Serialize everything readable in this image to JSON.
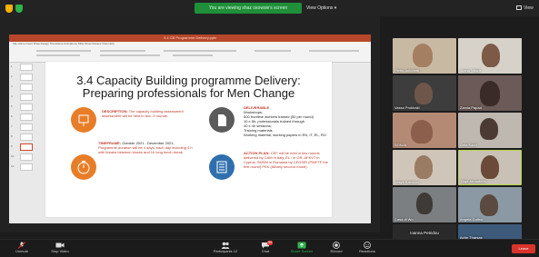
{
  "topbar": {
    "banner": "You are viewing shaz osowsie's screen",
    "view_options": "View Options",
    "view": "View"
  },
  "ppt": {
    "title_bar": "3.4 CB Programme Delivery.pptx",
    "ribbon_tabs": "File   Home   Insert   Draw   Design   Transitions   Animations   Slide Show   Review   View   Help"
  },
  "slide": {
    "title_line1": "3.4 Capacity Building programme Delivery:",
    "title_line2": "Preparing professionals for Men Change",
    "description_label": "DESCRIPTION:",
    "description_text": "The capacity building assessment assessment will be held in two -3 rounds.",
    "timeframe_label": "TIMEFRAME:",
    "timeframe_text": "October 2021 - December 2021;",
    "duration_text": "Programme duration will be 4 days, each day including 4 h with breaks between blocks and 1h long lunch break",
    "deliverable_label": "DELIVERABLE",
    "deliverable_lines": [
      "Workshops;",
      "500 frontline workers trained (50 per round)",
      "10 x 8h; professionals trained through",
      "40 x 4h sessions;",
      "Training materials",
      "Working material, working papers in EN, IT, EL, RO"
    ],
    "action_label": "ACTION PLAN:",
    "action_text": "CEF will be held in two rounds delivered by CAM in Italy, EL / in GR, AFKVT in Cyprus, SMSM in Romania by CEGSIR (PWFTF the first round) PKK (Albany second round)."
  },
  "participants": [
    {
      "name": "Pietro Antonetti"
    },
    {
      "name": "Juana Villadr"
    },
    {
      "name": "Vasso Prokiraki"
    },
    {
      "name": "Zamla Papad"
    },
    {
      "name": "SONJA"
    },
    {
      "name": "Gela Kacd"
    },
    {
      "name": "Lesya Kakakov"
    },
    {
      "name": "Olga Arnautova"
    },
    {
      "name": "Casa di Wo"
    },
    {
      "name": "Angela Colleo"
    },
    {
      "name": "Ioanna Petridou"
    },
    {
      "name": "Ache Tharsas"
    }
  ],
  "controls": {
    "unmute": "Unmute",
    "stop_video": "Stop Video",
    "participants": "Participants",
    "participants_count": "12",
    "chat": "Chat",
    "chat_badge": "99",
    "share_screen": "Share Screen",
    "record": "Record",
    "reactions": "Reactions",
    "end": "Leave"
  },
  "colors": {
    "accent_green": "#1f8f3a",
    "ppt_red": "#b7472a",
    "end_red": "#d9342b"
  }
}
